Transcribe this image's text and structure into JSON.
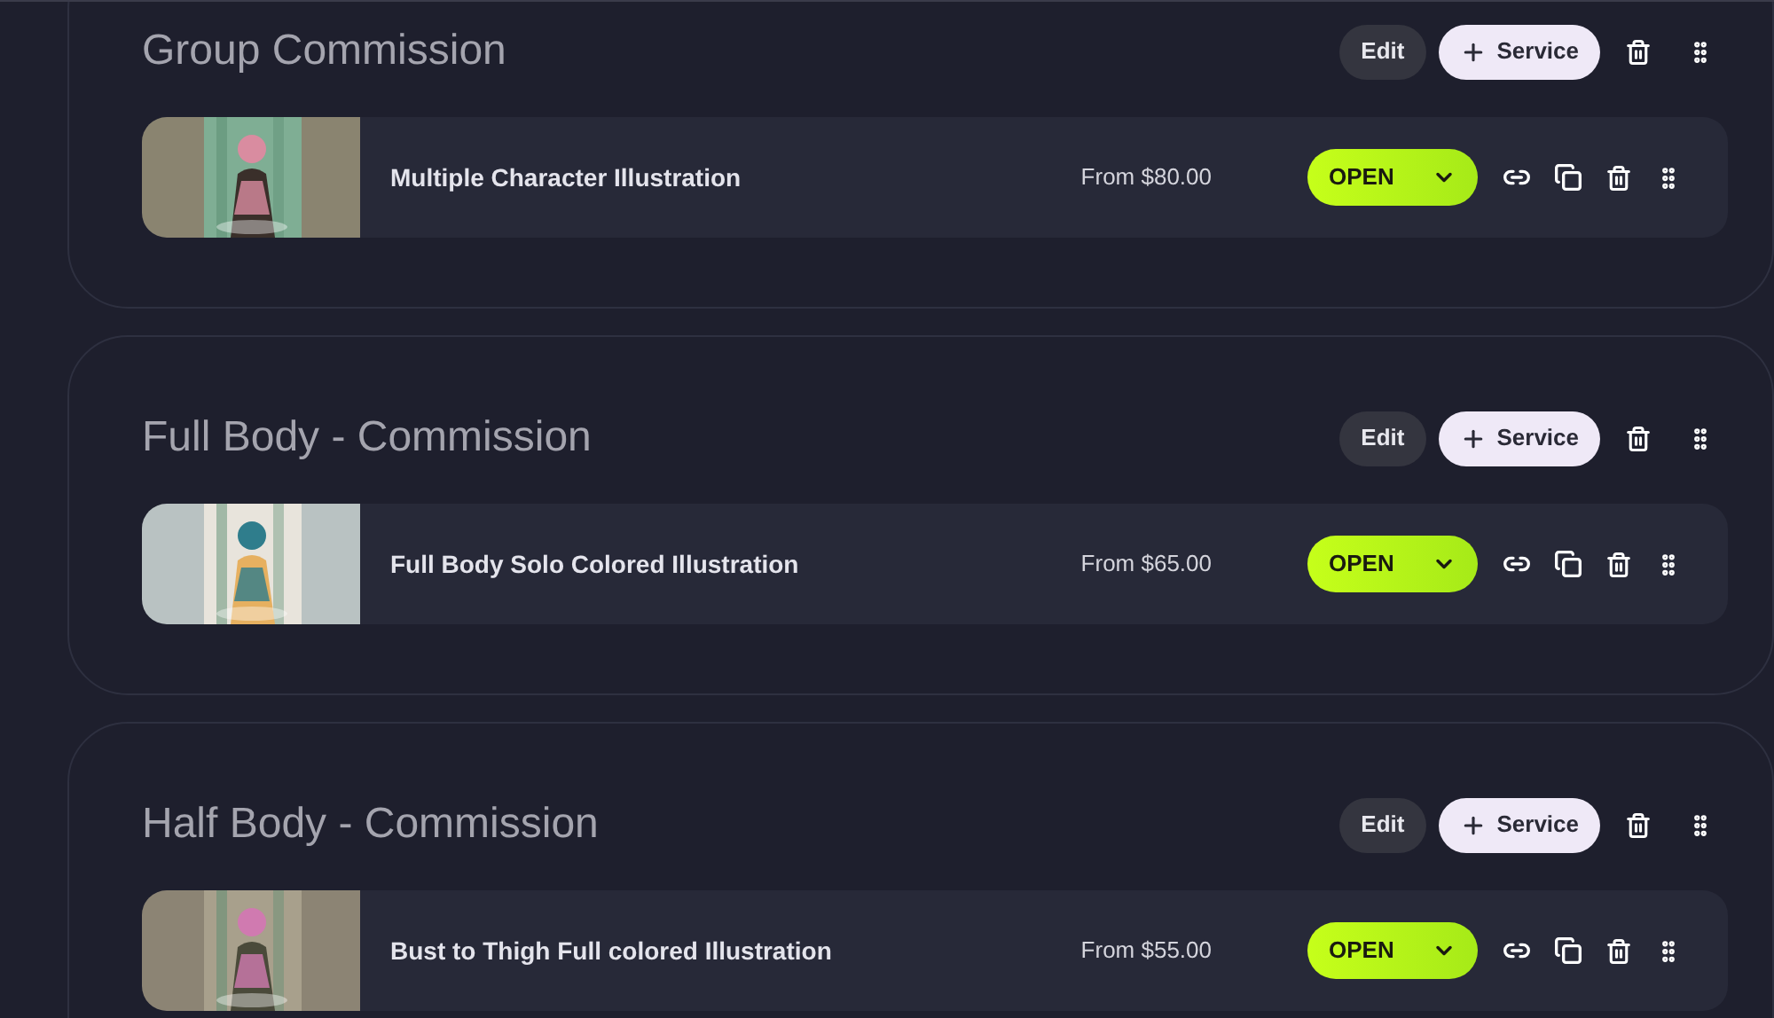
{
  "sections": [
    {
      "title": "Group Commission",
      "edit_label": "Edit",
      "add_label": "Service",
      "services": [
        {
          "name": "Multiple Character Illustration",
          "price": "From $80.00",
          "status": "OPEN"
        }
      ]
    },
    {
      "title": "Full Body - Commission",
      "edit_label": "Edit",
      "add_label": "Service",
      "services": [
        {
          "name": "Full Body Solo Colored Illustration",
          "price": "From $65.00",
          "status": "OPEN"
        }
      ]
    },
    {
      "title": "Half Body - Commission",
      "edit_label": "Edit",
      "add_label": "Service",
      "services": [
        {
          "name": "Bust to Thigh Full colored Illustration",
          "price": "From $55.00",
          "status": "OPEN"
        }
      ]
    }
  ]
}
